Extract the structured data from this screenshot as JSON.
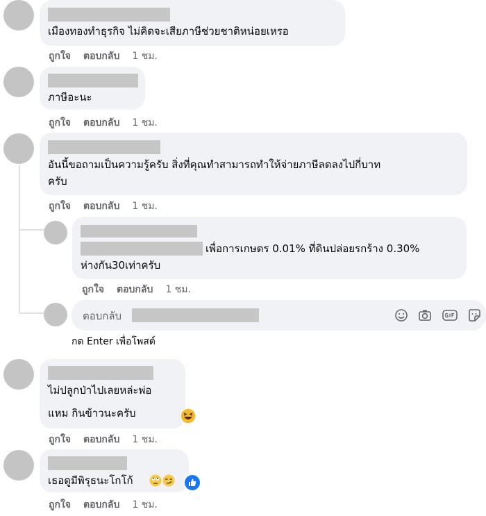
{
  "actions": {
    "like": "ถูกใจ",
    "reply": "ตอบกลับ"
  },
  "comments": [
    {
      "text_lines": [
        "เมืองทองทำธุรกิจ ไม่คิดจะเสียภาษีช่วยชาติหน่อยเหรอ"
      ],
      "time": "1 ชม."
    },
    {
      "text_lines": [
        "ภาษีอะนะ"
      ],
      "time": "1 ชม."
    },
    {
      "text_lines": [
        "อันนี้ขอถามเป็นความรู้ครับ สิ่งที่คุณทำสามารถทำให้จ่ายภาษีลดลงไปกี่บาท",
        "ครับ"
      ],
      "time": "1 ชม."
    },
    {
      "text_lines": [
        "เพื่อการเกษตร 0.01% ที่ดินปล่อยรกร้าง 0.30%",
        "ห่างกัน30เท่าครับ"
      ],
      "time": "1 ชม."
    },
    {
      "text_lines": [
        "ไม่ปลูกป่าไปเลยหล่ะพ่อ",
        "แหม กินข้าวนะครับ"
      ],
      "time": "1 ชม."
    },
    {
      "text_lines": [
        "เธอดูมีพิรุธนะโกโก้"
      ],
      "time": "1 ชม."
    }
  ],
  "reply_input": {
    "label": "ตอบกลับ",
    "hint": "กด Enter เพื่อโพสต์"
  },
  "icons": [
    "emoji-icon",
    "camera-icon",
    "gif-icon",
    "sticker-icon"
  ],
  "colors": {
    "bubble": "#f0f2f5",
    "redaction": "#c6c6c6",
    "meta": "#65676b",
    "like": "#1877f2"
  }
}
